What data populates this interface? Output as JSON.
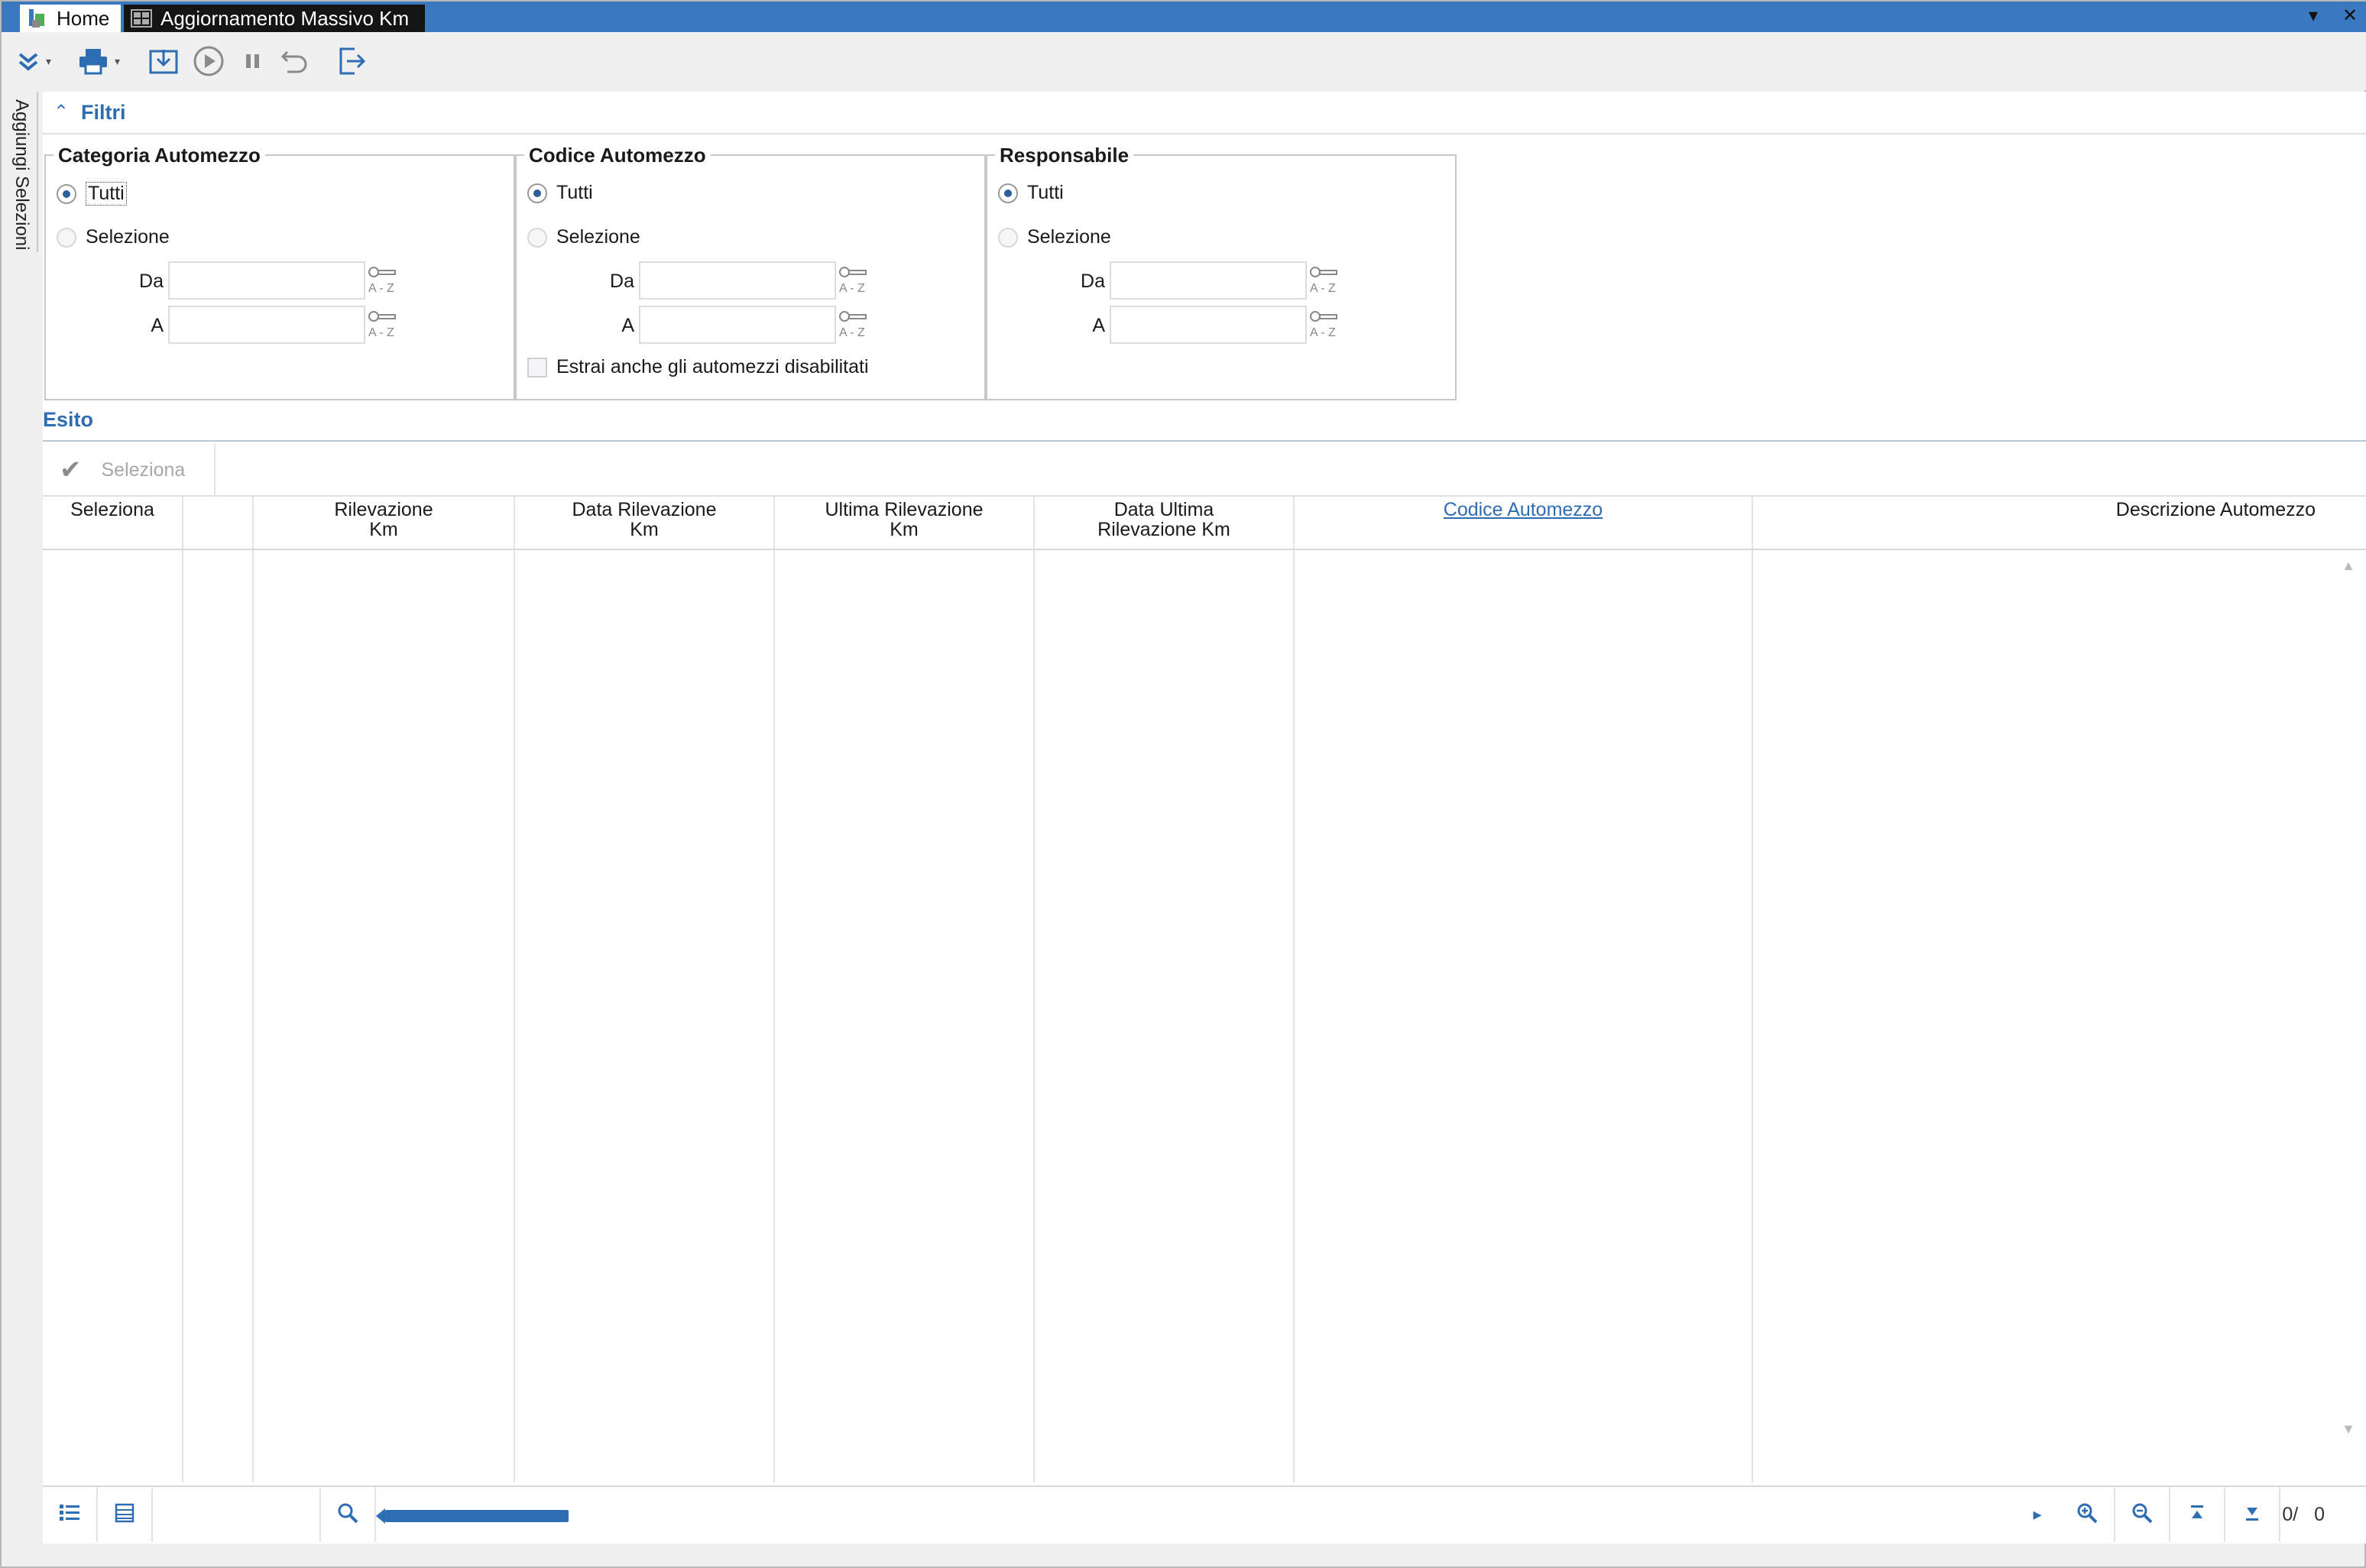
{
  "tabs": {
    "home": "Home",
    "active": "Aggiornamento Massivo Km"
  },
  "sidebar": {
    "vertical_tab": "Aggiungi Selezioni"
  },
  "filters": {
    "title": "Filtri",
    "groups": [
      {
        "legend": "Categoria Automezzo",
        "all_label": "Tutti",
        "selection_label": "Selezione",
        "from_label": "Da",
        "to_label": "A",
        "from_value": "",
        "to_value": "",
        "selected": "Tutti"
      },
      {
        "legend": "Codice Automezzo",
        "all_label": "Tutti",
        "selection_label": "Selezione",
        "from_label": "Da",
        "to_label": "A",
        "from_value": "",
        "to_value": "",
        "selected": "Tutti",
        "checkbox_label": "Estrai anche gli automezzi disabilitati"
      },
      {
        "legend": "Responsabile",
        "all_label": "Tutti",
        "selection_label": "Selezione",
        "from_label": "Da",
        "to_label": "A",
        "from_value": "",
        "to_value": "",
        "selected": "Tutti"
      }
    ]
  },
  "result": {
    "title": "Esito",
    "select_button": "Seleziona",
    "columns": [
      "Seleziona",
      "",
      "Rilevazione\nKm",
      "Data Rilevazione\nKm",
      "Ultima Rilevazione\nKm",
      "Data Ultima\nRilevazione Km",
      "Codice Automezzo",
      "Descrizione Automezzo"
    ],
    "rows": [],
    "pager": "0/   0"
  },
  "colors": {
    "accent": "#3a78c0",
    "link": "#2f6db3"
  }
}
